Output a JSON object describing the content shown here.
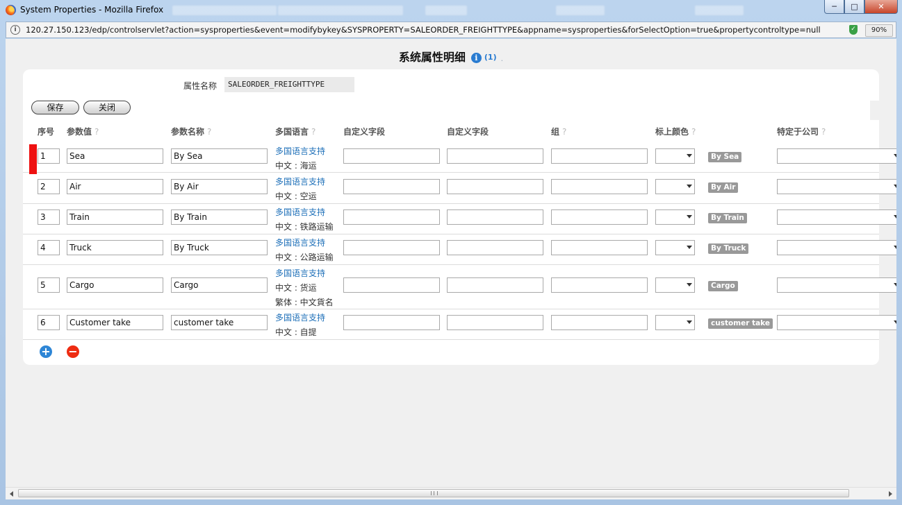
{
  "window": {
    "title": "System Properties - Mozilla Firefox",
    "url": "120.27.150.123/edp/controlservlet?action=sysproperties&event=modifybykey&SYSPROPERTY=SALEORDER_FREIGHTTYPE&appname=sysproperties&forSelectOption=true&propertycontroltype=null",
    "zoom": "90%"
  },
  "page": {
    "title": "系统属性明细",
    "count": "(1)",
    "dot": "."
  },
  "property": {
    "label": "属性名称",
    "value": "SALEORDER_FREIGHTTYPE"
  },
  "buttons": {
    "save": "保存",
    "close": "关闭"
  },
  "headers": {
    "seq": "序号",
    "value": "参数值",
    "name": "参数名称",
    "lang": "多国语言",
    "custom1": "自定义字段",
    "custom2": "自定义字段",
    "group": "组",
    "color": "标上颜色",
    "company": "特定于公司"
  },
  "rows": [
    {
      "seq": "1",
      "value": "Sea",
      "name": "By Sea",
      "lang_link": "多国语言支持",
      "lang_lines": [
        "中文 : 海运"
      ],
      "badge": "By Sea"
    },
    {
      "seq": "2",
      "value": "Air",
      "name": "By Air",
      "lang_link": "多国语言支持",
      "lang_lines": [
        "中文 : 空运"
      ],
      "badge": "By Air"
    },
    {
      "seq": "3",
      "value": "Train",
      "name": "By Train",
      "lang_link": "多国语言支持",
      "lang_lines": [
        "中文 : 铁路运输"
      ],
      "badge": "By Train"
    },
    {
      "seq": "4",
      "value": "Truck",
      "name": "By Truck",
      "lang_link": "多国语言支持",
      "lang_lines": [
        "中文 : 公路运输"
      ],
      "badge": "By Truck"
    },
    {
      "seq": "5",
      "value": "Cargo",
      "name": "Cargo",
      "lang_link": "多国语言支持",
      "lang_lines": [
        "中文 : 货运",
        "繁体 : 中文貨名"
      ],
      "badge": "Cargo"
    },
    {
      "seq": "6",
      "value": "Customer take",
      "name": "customer take",
      "lang_link": "多国语言支持",
      "lang_lines": [
        "中文 : 自提"
      ],
      "badge": "customer take"
    }
  ]
}
